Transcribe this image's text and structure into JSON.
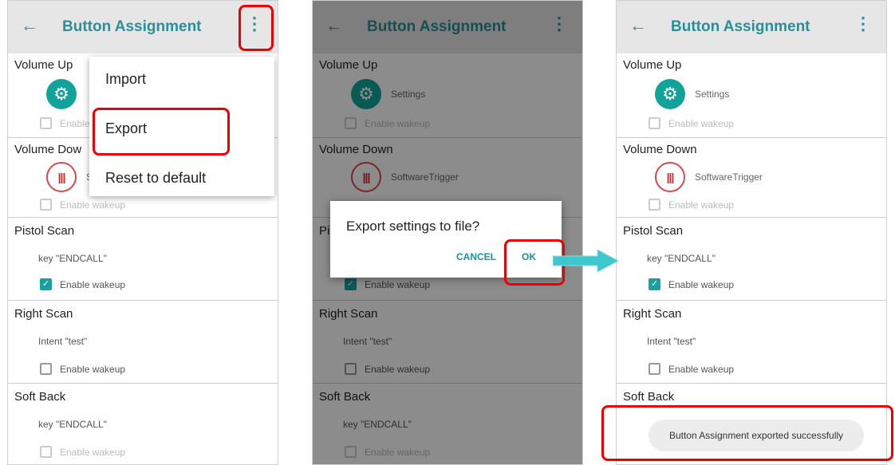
{
  "colors": {
    "accent": "#2a8f9a",
    "checkbox_on": "#18a0a6",
    "highlight": "#ff0000",
    "arrow": "#3fc7cf"
  },
  "toolbar": {
    "back_icon": "arrow-left",
    "title": "Button Assignment",
    "more_icon": "vertical-dots"
  },
  "sections": {
    "volume_up": {
      "title": "Volume Up",
      "app": "Settings",
      "app_icon": "gear",
      "wake_label": "Enable wakeup",
      "wake_checked": false
    },
    "volume_down": {
      "title": "Volume Down",
      "app": "SoftwareTrigger",
      "app_icon": "barcode",
      "wake_label": "Enable wakeup",
      "wake_checked": false
    },
    "pistol_scan": {
      "title": "Pistol Scan",
      "key": "key \"ENDCALL\"",
      "wake_label": "Enable wakeup",
      "wake_checked": true
    },
    "right_scan": {
      "title": "Right Scan",
      "key": "Intent \"test\"",
      "wake_label": "Enable wakeup",
      "wake_checked": false
    },
    "soft_back": {
      "title": "Soft Back",
      "key": "key \"ENDCALL\"",
      "wake_label": "Enable wakeup",
      "wake_checked": false
    }
  },
  "panel1": {
    "partial": {
      "volume_up_wake": "Enable",
      "volume_down_app": "So",
      "volume_down_title": "Volume Dow"
    },
    "menu": {
      "items": [
        "Import",
        "Export",
        "Reset to default"
      ]
    }
  },
  "panel2": {
    "pistol_scan_partial": "Pi",
    "dialog": {
      "message": "Export settings to file?",
      "cancel": "CANCEL",
      "ok": "OK"
    }
  },
  "panel3": {
    "soft_back_key_partial": "key \"ENDCALL\"",
    "toast": "Button Assignment exported successfully"
  }
}
